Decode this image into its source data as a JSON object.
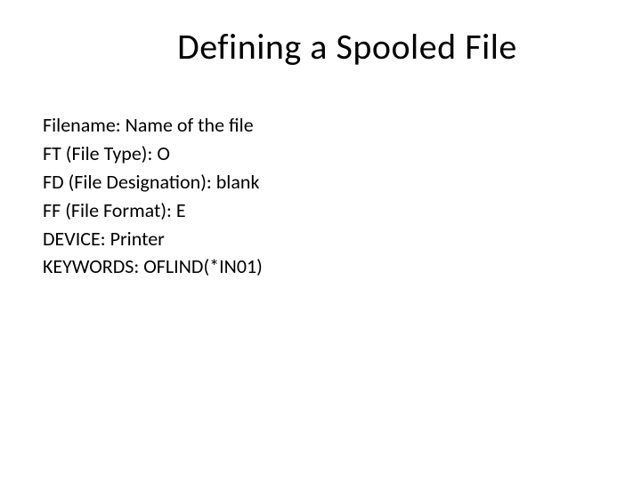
{
  "title": "Defining a Spooled File",
  "lines": [
    "Filename: Name of the file",
    "FT (File Type):  O",
    "FD (File Designation): blank",
    "FF (File Format): E",
    "DEVICE: Printer",
    "KEYWORDS: OFLIND(*IN01)"
  ]
}
